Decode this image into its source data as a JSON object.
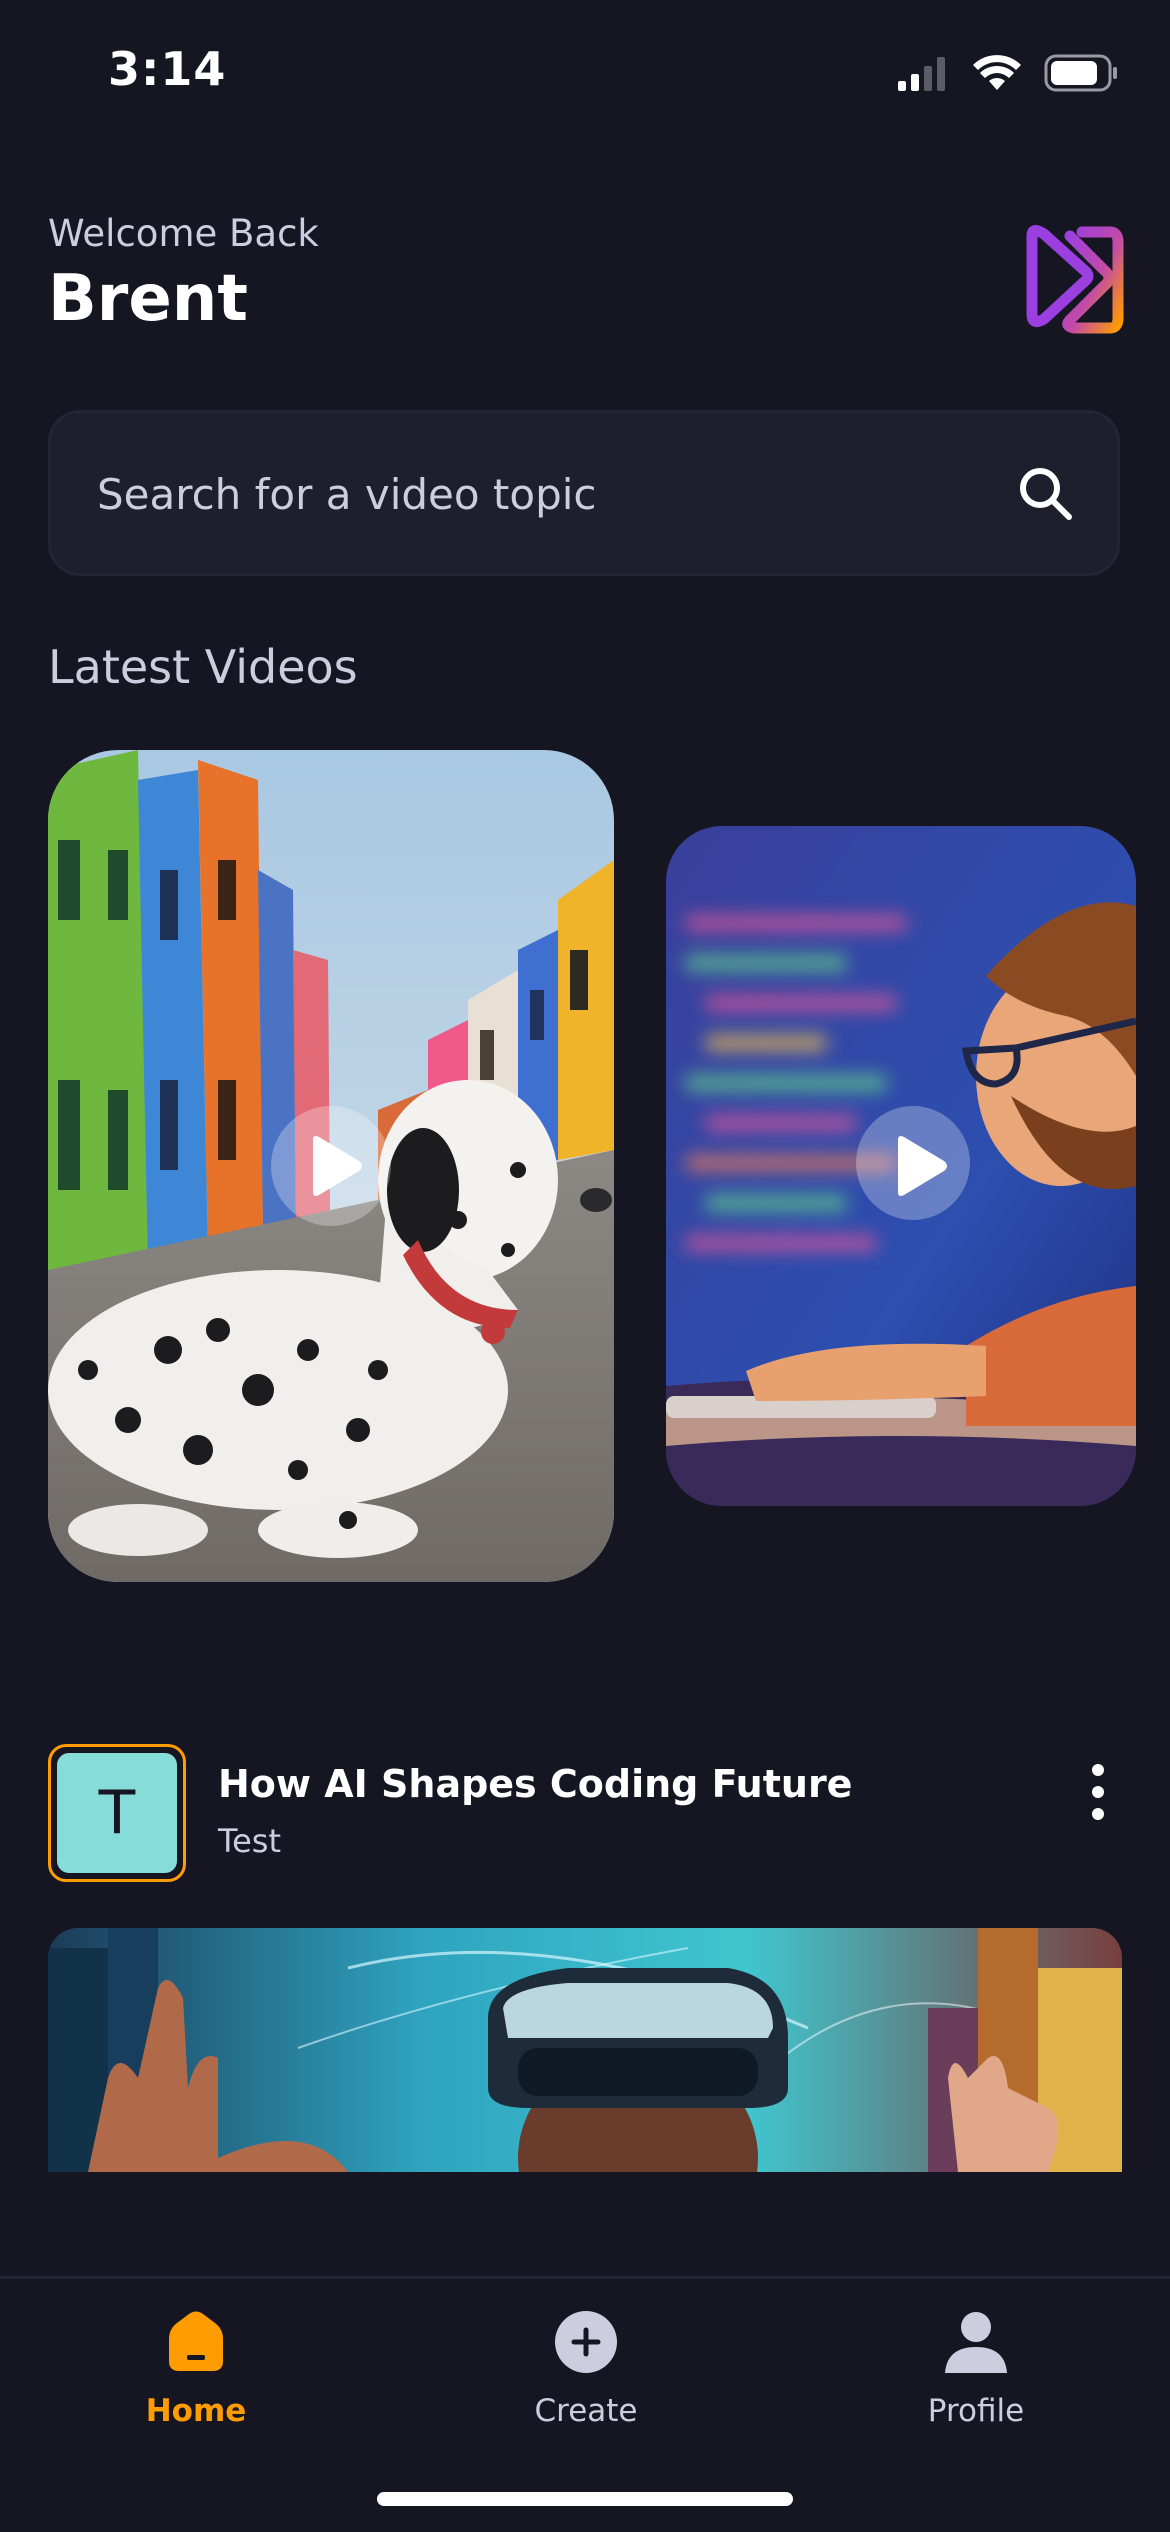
{
  "status_bar": {
    "time": "3:14"
  },
  "header": {
    "welcome": "Welcome Back",
    "username": "Brent",
    "logo_icon": "app-logo"
  },
  "search": {
    "placeholder": "Search for a video topic",
    "value": ""
  },
  "latest": {
    "title": "Latest Videos",
    "cards": [
      {
        "thumbnail": "dalmatian-on-colorful-street"
      },
      {
        "thumbnail": "bearded-man-at-keyboard"
      }
    ]
  },
  "videos": [
    {
      "avatar_letter": "T",
      "title": "How AI Shapes Coding Future",
      "creator": "Test",
      "thumbnail": "person-with-vr-headset"
    }
  ],
  "tabs": [
    {
      "label": "Home",
      "icon": "home-icon",
      "active": true
    },
    {
      "label": "Create",
      "icon": "plus-circle-icon",
      "active": false
    },
    {
      "label": "Profile",
      "icon": "user-icon",
      "active": false
    }
  ],
  "colors": {
    "background": "#161622",
    "accent": "#ff9c01",
    "muted_text": "#cdcde0",
    "field": "#1e1e2d"
  }
}
